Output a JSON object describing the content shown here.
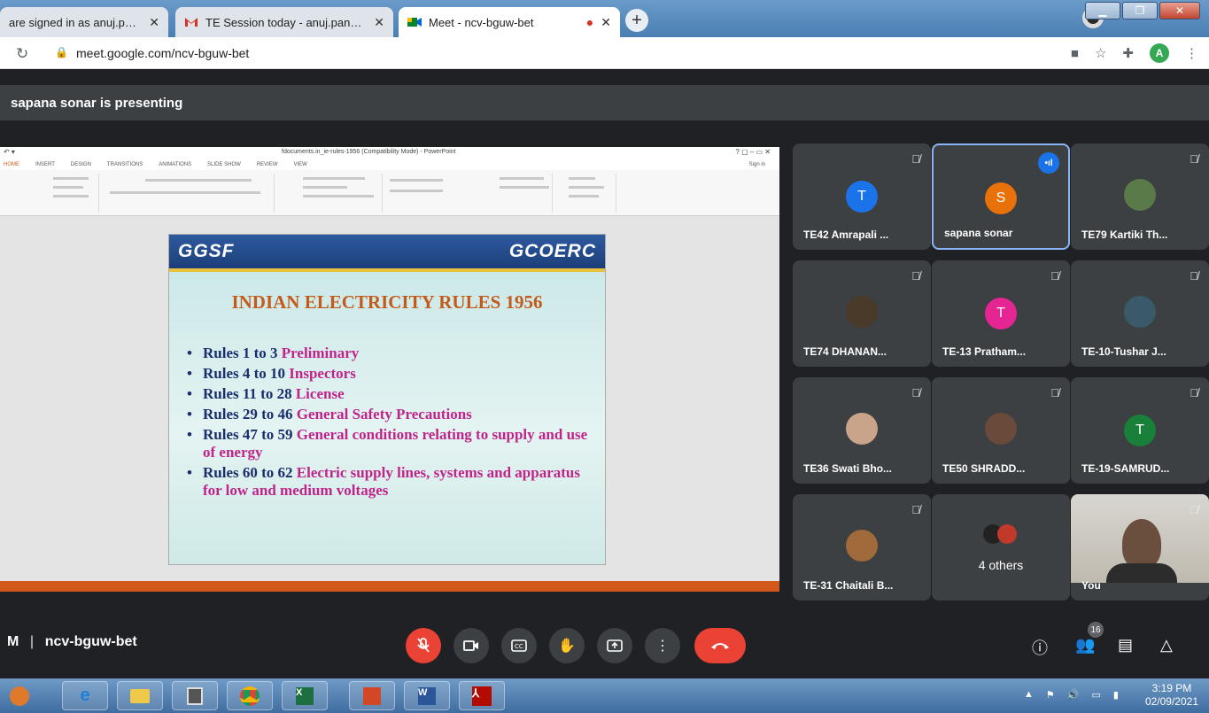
{
  "browser": {
    "tabs": [
      {
        "title": "are signed in as anuj.pandey"
      },
      {
        "title": "TE Session today - anuj.pandey@"
      },
      {
        "title": "Meet - ncv-bguw-bet"
      }
    ],
    "url": "meet.google.com/ncv-bguw-bet",
    "profile_letter": "A"
  },
  "meet": {
    "presenting_text": "sapana sonar is presenting",
    "meeting_code": "ncv-bguw-bet",
    "meeting_code_prefix": "M",
    "people_count": "16"
  },
  "ppt": {
    "window_title": "fdocuments.in_ie-rules-1956 (Compatibility Mode) - PowerPoint",
    "ribbon_tabs": [
      "HOME",
      "INSERT",
      "DESIGN",
      "TRANSITIONS",
      "ANIMATIONS",
      "SLIDE SHOW",
      "REVIEW",
      "VIEW"
    ],
    "sign_in": "Sign in"
  },
  "slide": {
    "header_left": "GGSF",
    "header_right": "GCOERC",
    "title": "INDIAN ELECTRICITY RULES 1956",
    "bullets": [
      {
        "rule": "Rules 1 to 3",
        "desc": "Preliminary"
      },
      {
        "rule": "Rules 4 to 10",
        "desc": "Inspectors"
      },
      {
        "rule": "Rules 11 to 28",
        "desc": "License"
      },
      {
        "rule": "Rules 29 to 46",
        "desc": "General Safety Precautions"
      },
      {
        "rule": "Rules 47 to 59",
        "desc": "General conditions relating to supply and use of energy"
      },
      {
        "rule": "Rules 60 to 62",
        "desc": "Electric supply lines, systems and apparatus for low and medium voltages"
      }
    ]
  },
  "participants": [
    {
      "name": "TE42 Amrapali ...",
      "avatar_letter": "T",
      "avatar_color": "#1a73e8",
      "muted": true
    },
    {
      "name": "sapana sonar",
      "avatar_letter": "S",
      "avatar_color": "#e8710a",
      "muted": false,
      "speaking": true
    },
    {
      "name": "TE79 Kartiki Th...",
      "avatar_color": "#5a7a4a",
      "muted": true
    },
    {
      "name": "TE74 DHANAN...",
      "avatar_color": "#4a3a2a",
      "muted": true
    },
    {
      "name": "TE-13 Pratham...",
      "avatar_letter": "T",
      "avatar_color": "#e52592",
      "muted": true
    },
    {
      "name": "TE-10-Tushar J...",
      "avatar_color": "#3a5a6a",
      "muted": true
    },
    {
      "name": "TE36 Swati Bho...",
      "avatar_color": "#c9a48a",
      "muted": true
    },
    {
      "name": "TE50 SHRADD...",
      "avatar_color": "#6a4a3a",
      "muted": true
    },
    {
      "name": "TE-19-SAMRUD...",
      "avatar_letter": "T",
      "avatar_color": "#188038",
      "muted": true
    },
    {
      "name": "TE-31 Chaitali B...",
      "avatar_color": "#a06a3a",
      "muted": true
    },
    {
      "others_label": "4 others"
    },
    {
      "name": "You",
      "muted": true
    }
  ],
  "taskbar": {
    "time": "3:19 PM",
    "date": "02/09/2021"
  },
  "colors": {
    "meet_bg": "#202124",
    "tile_bg": "#3c4043",
    "red": "#ea4335",
    "blue": "#1a73e8"
  }
}
